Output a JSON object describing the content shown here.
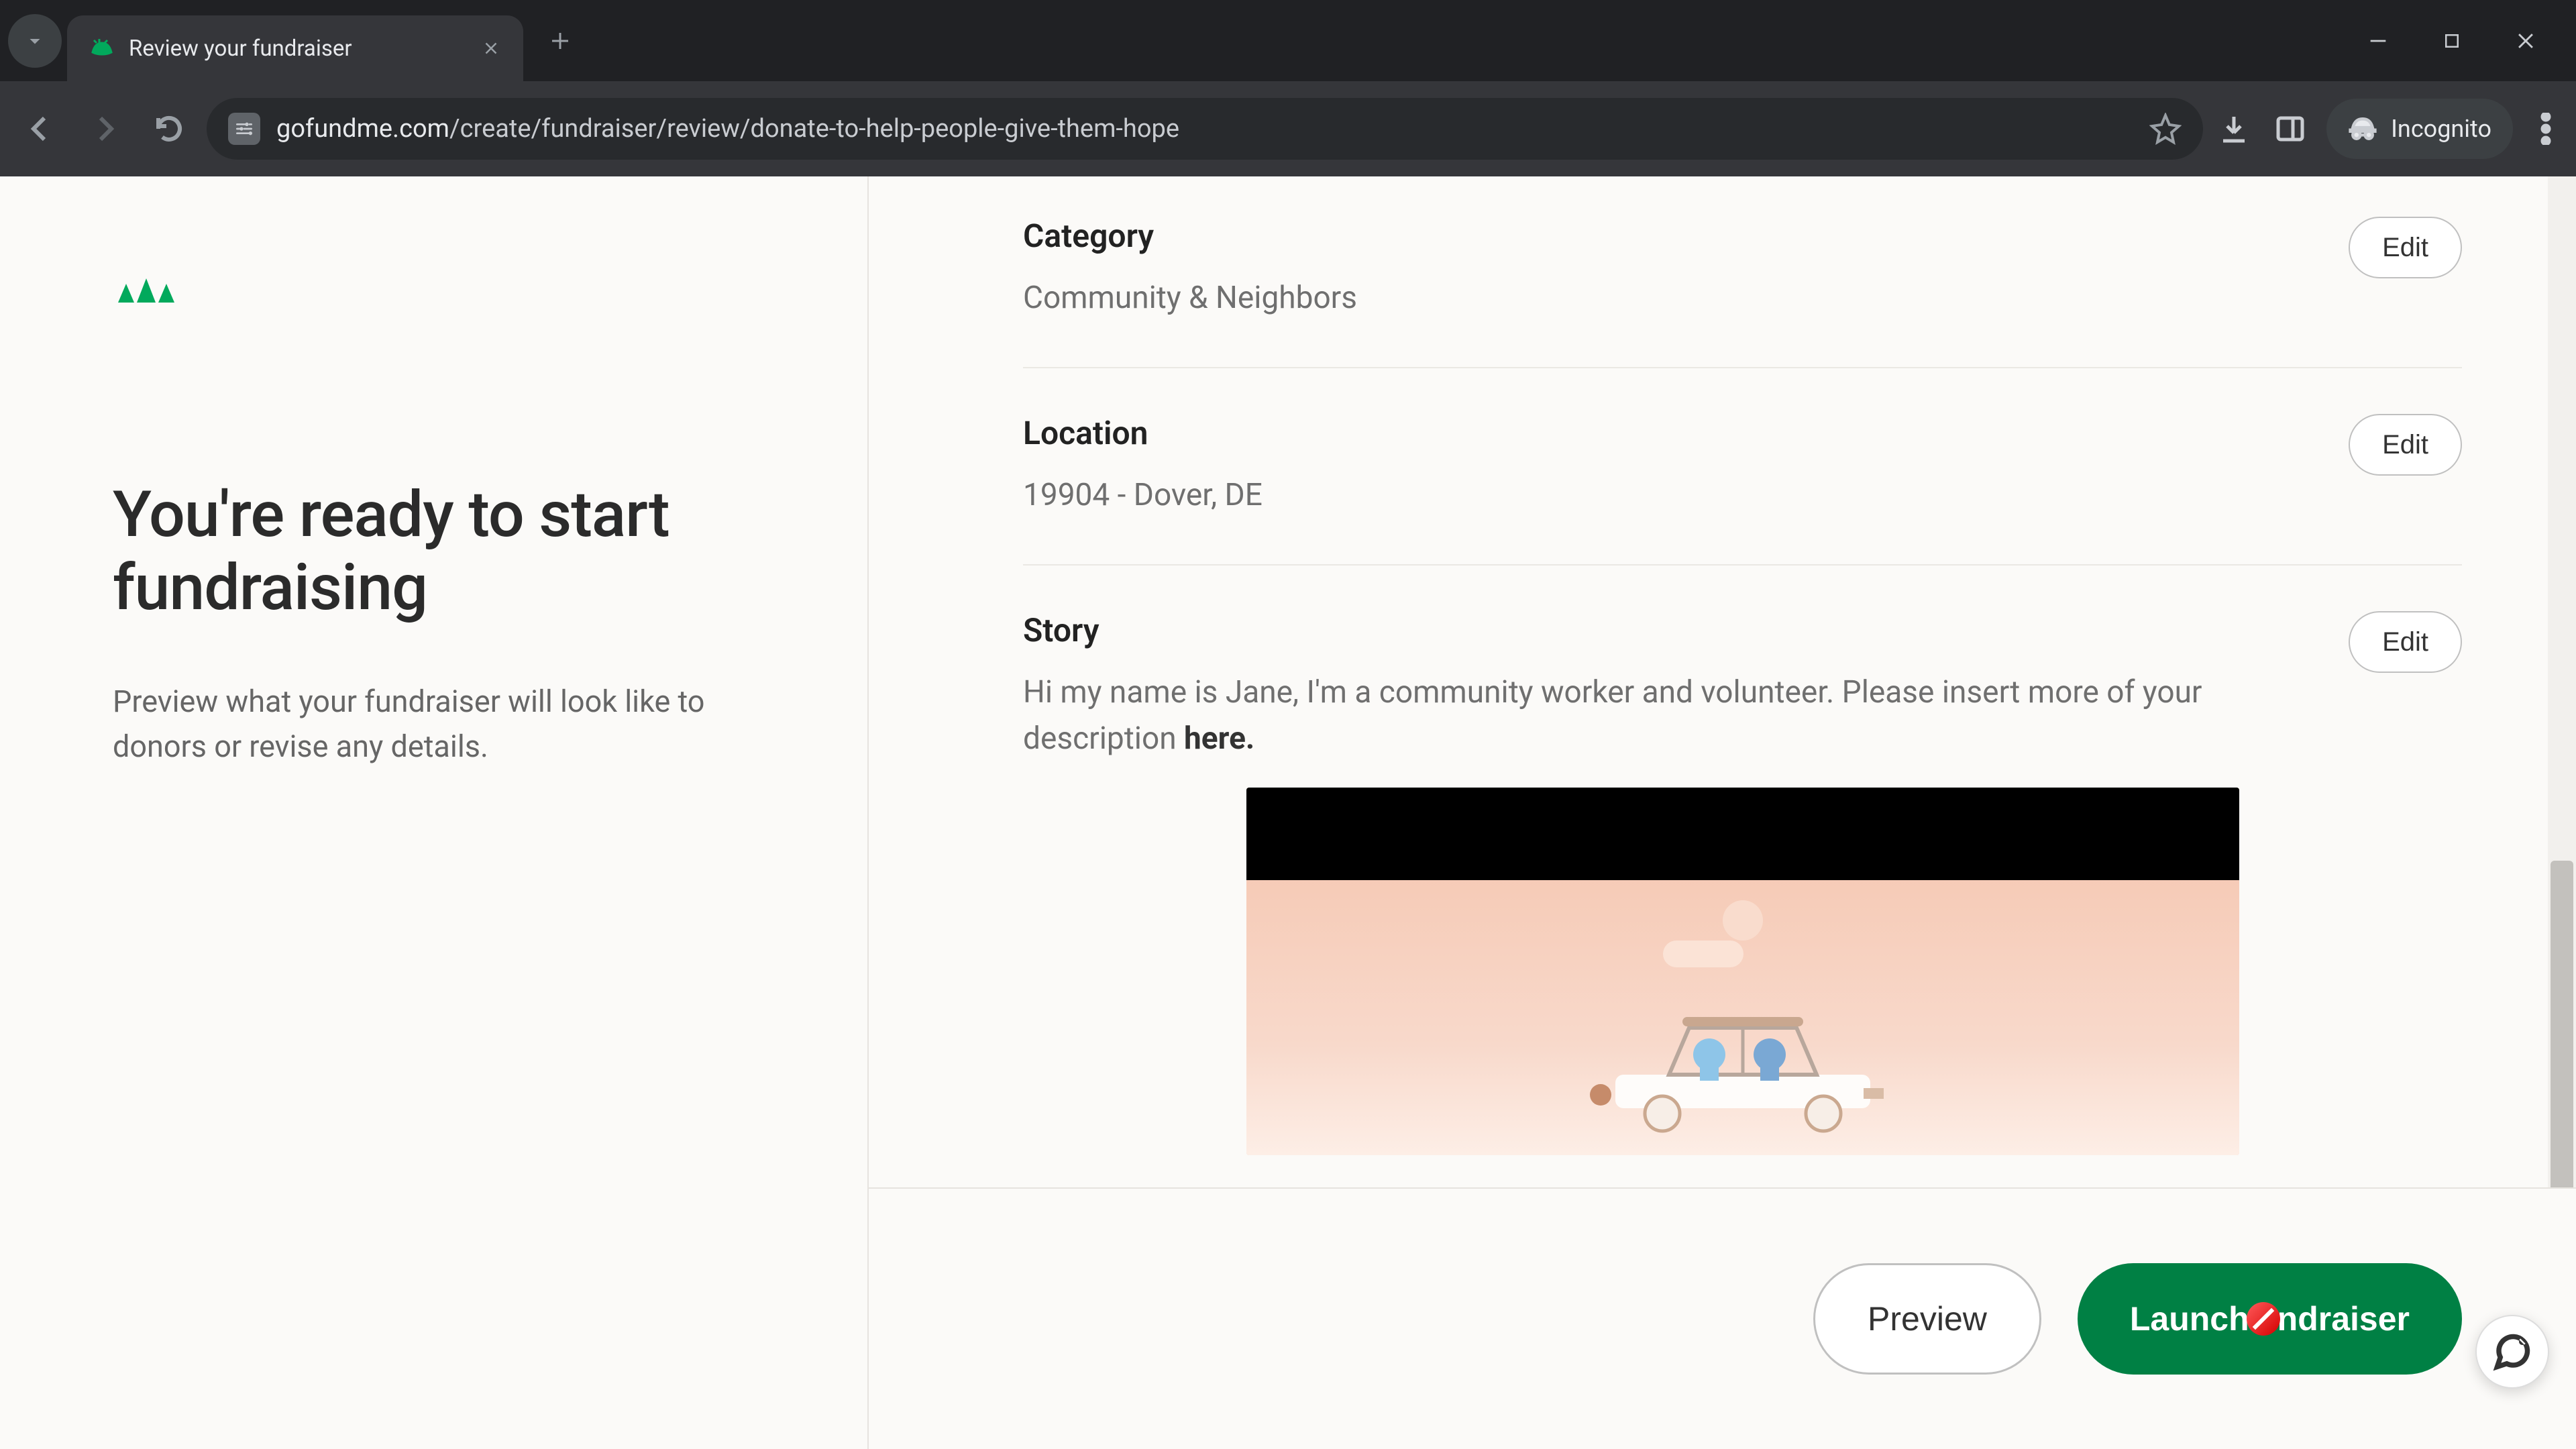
{
  "browser": {
    "tab_title": "Review your fundraiser",
    "url_domain": "gofundme.com",
    "url_path": "/create/fundraiser/review/donate-to-help-people-give-them-hope",
    "incognito_label": "Incognito"
  },
  "sidebar": {
    "headline": "You're ready to start fundraising",
    "subtext": "Preview what your fundraiser will look like to donors or revise any details."
  },
  "sections": {
    "category": {
      "heading": "Category",
      "value": "Community & Neighbors",
      "edit": "Edit"
    },
    "location": {
      "heading": "Location",
      "value": "19904 - Dover, DE",
      "edit": "Edit"
    },
    "story": {
      "heading": "Story",
      "value_prefix": "Hi my name is Jane, I'm a community worker and volunteer. Please insert more of your description ",
      "value_bold": "here.",
      "edit": "Edit"
    }
  },
  "footer": {
    "preview": "Preview",
    "launch_prefix": "Launch ",
    "launch_suffix": "ndraiser"
  }
}
